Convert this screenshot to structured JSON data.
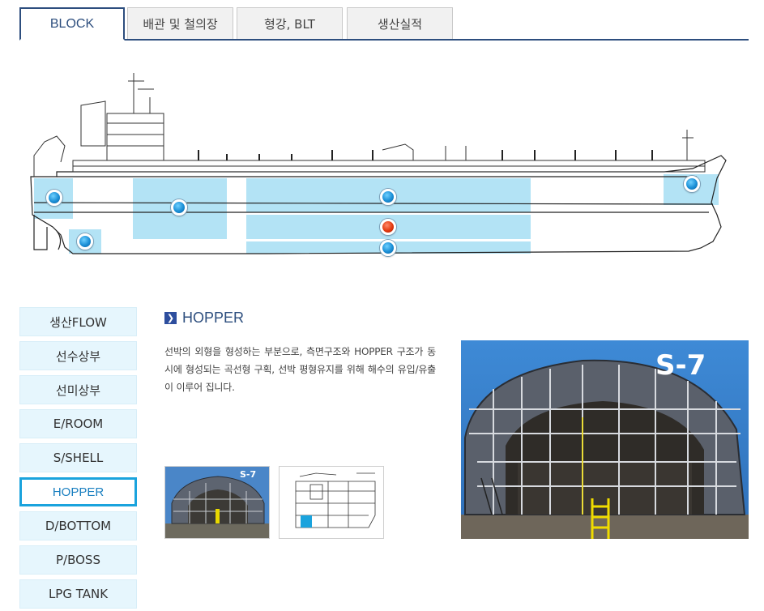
{
  "tabs": [
    {
      "label": "BLOCK",
      "active": true
    },
    {
      "label": "배관 및 철의장",
      "active": false
    },
    {
      "label": "형강, BLT",
      "active": false
    },
    {
      "label": "생산실적",
      "active": false
    }
  ],
  "sidenav": {
    "items": [
      {
        "label": "생산FLOW",
        "active": false
      },
      {
        "label": "선수상부",
        "active": false
      },
      {
        "label": "선미상부",
        "active": false
      },
      {
        "label": "E/ROOM",
        "active": false
      },
      {
        "label": "S/SHELL",
        "active": false
      },
      {
        "label": "HOPPER",
        "active": true
      },
      {
        "label": "D/BOTTOM",
        "active": false
      },
      {
        "label": "P/BOSS",
        "active": false
      },
      {
        "label": "LPG TANK",
        "active": false
      }
    ]
  },
  "content": {
    "title": "HOPPER",
    "description": "선박의 외형을 형성하는 부분으로, 측면구조와 HOPPER 구조가 동시에 형성되는 곡선형 구획, 선박 평형유지를 위해 해수의 유입/유출이 이루어 집니다.",
    "photo_label": "S-7",
    "thumb_label": "S-7"
  },
  "colors": {
    "brand": "#2d4e7e",
    "nav_bg": "#e6f6fd",
    "nav_active_border": "#1aa3dd",
    "highlight": "#b3e3f5",
    "marker_active": "#e23a10",
    "marker": "#1b8fd6"
  }
}
